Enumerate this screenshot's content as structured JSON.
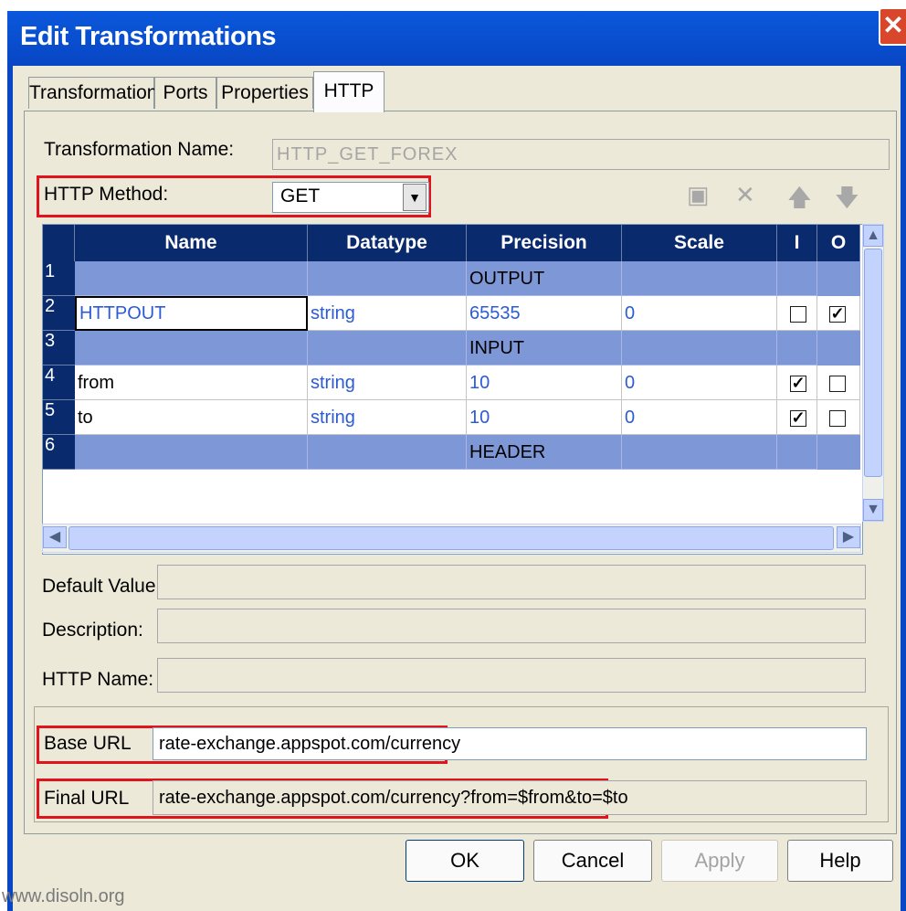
{
  "window": {
    "title": "Edit Transformations"
  },
  "tabs": [
    {
      "label": "Transformation"
    },
    {
      "label": "Ports"
    },
    {
      "label": "Properties"
    },
    {
      "label": "HTTP",
      "active": true
    }
  ],
  "form": {
    "transformation_name_label": "Transformation Name:",
    "transformation_name_value": "HTTP_GET_FOREX",
    "http_method_label": "HTTP Method:",
    "http_method_value": "GET"
  },
  "toolbar": {
    "icons": [
      "new-port-icon",
      "delete-icon",
      "move-up-icon",
      "move-down-icon"
    ]
  },
  "grid": {
    "columns": [
      "Name",
      "Datatype",
      "Precision",
      "Scale",
      "I",
      "O"
    ],
    "rows": [
      {
        "num": "1",
        "group": "OUTPUT"
      },
      {
        "num": "2",
        "name": "HTTPOUT",
        "datatype": "string",
        "precision": "65535",
        "scale": "0",
        "i": false,
        "o": true
      },
      {
        "num": "3",
        "group": "INPUT"
      },
      {
        "num": "4",
        "name": "from",
        "datatype": "string",
        "precision": "10",
        "scale": "0",
        "i": true,
        "o": false
      },
      {
        "num": "5",
        "name": "to",
        "datatype": "string",
        "precision": "10",
        "scale": "0",
        "i": true,
        "o": false
      },
      {
        "num": "6",
        "group": "HEADER"
      }
    ]
  },
  "details": {
    "default_value_label": "Default Value:",
    "default_value": "",
    "description_label": "Description:",
    "description": "",
    "http_name_label": "HTTP Name:",
    "http_name": ""
  },
  "url": {
    "base_url_label": "Base URL",
    "base_url_value": "rate-exchange.appspot.com/currency",
    "final_url_label": "Final URL",
    "final_url_value": "rate-exchange.appspot.com/currency?from=$from&to=$to"
  },
  "buttons": {
    "ok": "OK",
    "cancel": "Cancel",
    "apply": "Apply",
    "help": "Help"
  },
  "watermark": "www.disoln.org",
  "colors": {
    "titlebar": "#0846c4",
    "highlight": "#e0141c",
    "group_row": "#7d97d7",
    "header": "#0a2a6e"
  }
}
